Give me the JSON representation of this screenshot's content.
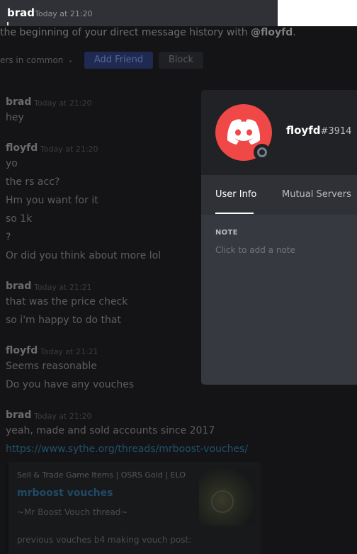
{
  "topbar": {
    "author": "brad",
    "time": "Today at 21:20"
  },
  "intro": {
    "prefix": "the beginning of your direct message history with ",
    "user": "@floyfd",
    "suffix": "."
  },
  "actions": {
    "common": "ers in common",
    "add_friend": "Add Friend",
    "block": "Block"
  },
  "messages": [
    {
      "author": "brad",
      "time": "Today at 21:20",
      "lines": [
        "hey"
      ]
    },
    {
      "author": "floyfd",
      "time": "Today at 21:20",
      "lines": [
        "yo",
        "the rs acc?",
        "Hm you want for it",
        "so 1k",
        "?",
        "Or did you think about more lol"
      ]
    },
    {
      "author": "brad",
      "time": "Today at 21:21",
      "lines": [
        "that was the price check",
        "so i'm happy to do that"
      ]
    },
    {
      "author": "floyfd",
      "time": "Today at 21:21",
      "lines": [
        "Seems reasonable",
        "Do you have any vouches"
      ]
    },
    {
      "author": "brad",
      "time": "Today at 21:20",
      "lines": [
        "yeah, made and sold accounts since 2017"
      ],
      "link": "https://www.sythe.org/threads/mrboost-vouches/"
    }
  ],
  "embed": {
    "provider": "Sell & Trade Game Items | OSRS Gold | ELO",
    "title": "mrboost vouches",
    "description": "~Mr Boost Vouch thread~",
    "more": "previous vouches b4 making vouch post:"
  },
  "popout": {
    "username": "floyfd",
    "discriminator": "#3914",
    "tabs": [
      "User Info",
      "Mutual Servers"
    ],
    "active_tab": "User Info",
    "note_label": "NOTE",
    "note_placeholder": "Click to add a note",
    "avatar_color": "#f04747",
    "status": "offline"
  },
  "colors": {
    "background": "#36393f",
    "overlay": "#141416",
    "accent": "#7289da"
  }
}
